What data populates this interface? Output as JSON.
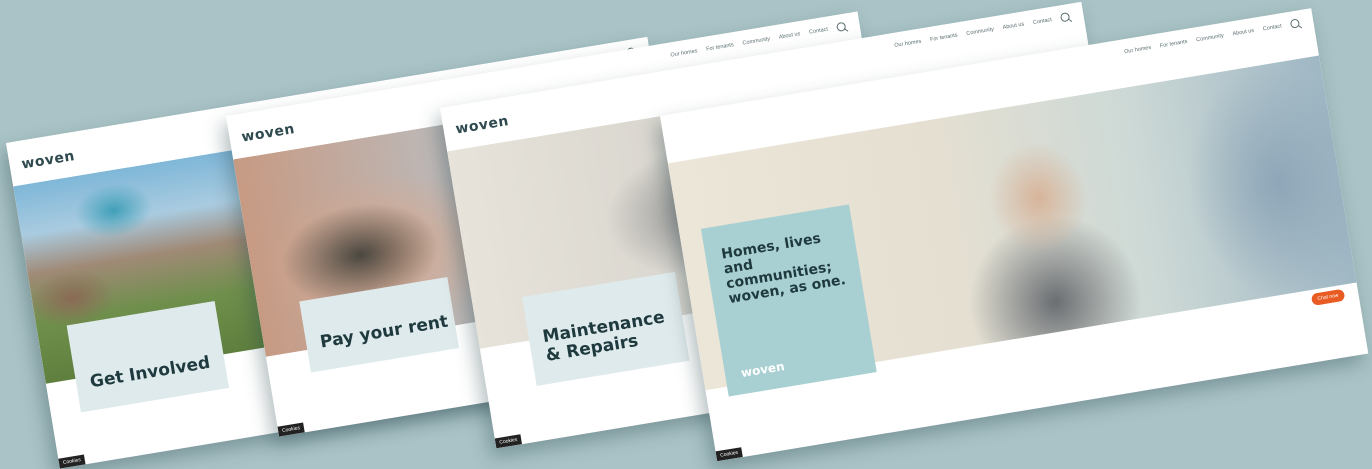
{
  "nav": {
    "items": [
      "Our homes",
      "For tenants",
      "Community",
      "About us",
      "Contact"
    ]
  },
  "logo": "woven",
  "cookies_label": "Cookies",
  "pages": [
    {
      "card_title": "Get Involved"
    },
    {
      "card_title": "Pay your rent"
    },
    {
      "card_title": "Maintenance & Repairs"
    },
    {
      "card_title": "Homes, lives and communities; woven, as one.",
      "card_logo": "woven",
      "chat_label": "Chat now"
    }
  ],
  "colors": {
    "background": "#a9c3c6",
    "card_light": "#dfeaec",
    "card_teal": "#a8cfd2",
    "brand_dark": "#2f4a4e",
    "chat_orange": "#e85b22"
  }
}
